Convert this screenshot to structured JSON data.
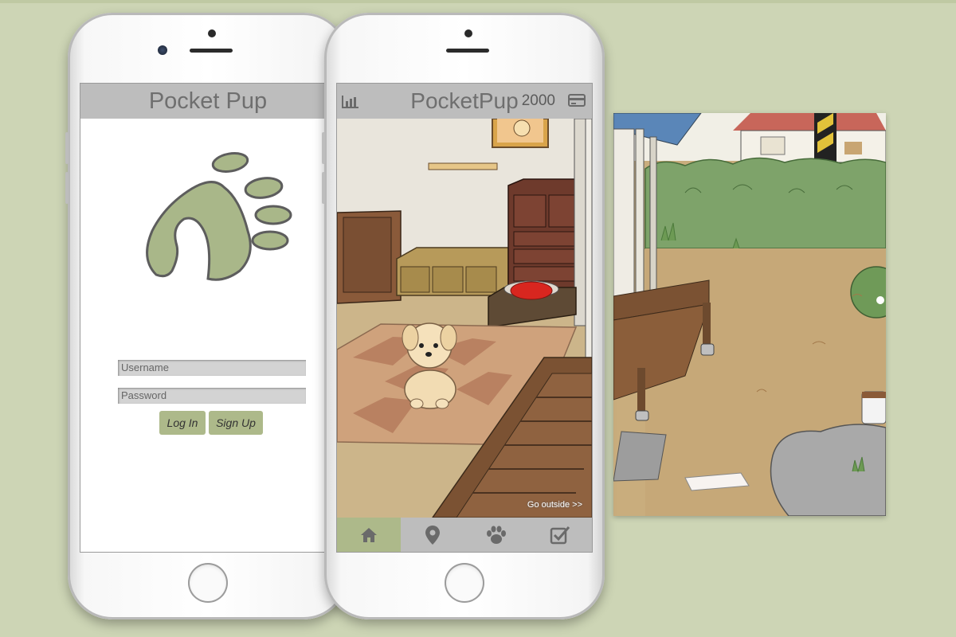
{
  "login_screen": {
    "app_title": "Pocket Pup",
    "logo_icon": "paw-logo-icon",
    "username_placeholder": "Username",
    "password_placeholder": "Password",
    "login_label": "Log In",
    "signup_label": "Sign Up",
    "accent_color": "#adb98a"
  },
  "game_screen": {
    "app_title": "PocketPup",
    "coin_count": "2000",
    "stats_icon": "bar-chart-icon",
    "wallet_icon": "credit-card-icon",
    "go_outside_label": "Go outside >>",
    "tabs": [
      {
        "icon": "home-icon",
        "active": true
      },
      {
        "icon": "map-pin-icon",
        "active": false
      },
      {
        "icon": "paw-icon",
        "active": false
      },
      {
        "icon": "checkbox-icon",
        "active": false
      }
    ]
  },
  "colors": {
    "background": "#cdd5b5",
    "header_gray": "#bdbdbd",
    "title_gray": "#6f6f6f"
  }
}
